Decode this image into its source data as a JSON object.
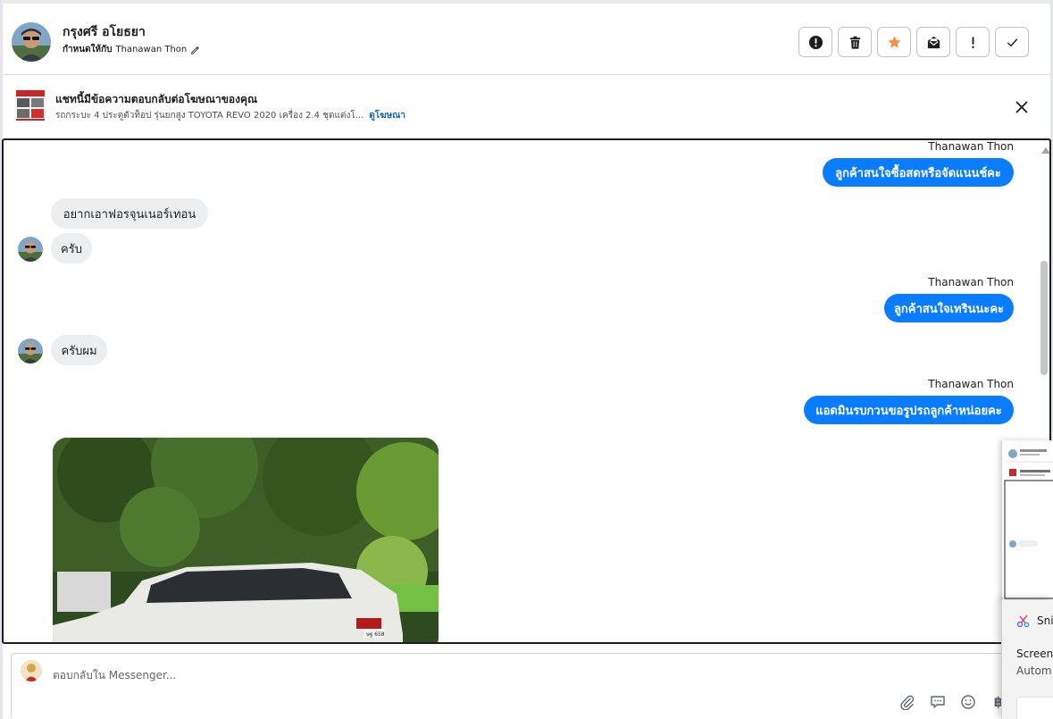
{
  "header": {
    "contact_name": "กรุงศรี อโยธยา",
    "assign_prefix": "กำหนดให้กับ",
    "assignee": "Thanawan Thon"
  },
  "toolbar": {
    "buttons": [
      {
        "name": "report-spam-button",
        "icon": "alert-circle-icon"
      },
      {
        "name": "delete-button",
        "icon": "trash-icon"
      },
      {
        "name": "star-button",
        "icon": "star-icon",
        "active_color": "#f7923b"
      },
      {
        "name": "mark-unread-button",
        "icon": "envelope-icon"
      },
      {
        "name": "follow-up-button",
        "icon": "exclamation-icon"
      },
      {
        "name": "mark-done-button",
        "icon": "checkmark-icon"
      }
    ]
  },
  "ad_banner": {
    "title": "แชทนี้มีข้อความตอบกลับต่อโฆษณาของคุณ",
    "description": "รถกระบะ 4 ประตูตัวท็อป รุ่นยกสูง TOYOTA REVO 2020 เครื่อง 2.4 ชุดแต่งโ...",
    "link_text": "ดูโฆษณา"
  },
  "messages": {
    "out1": {
      "sender": "Thanawan Thon",
      "text": "ลูกค้าสนใจซื้อสดหรือจัดแนนช์คะ"
    },
    "in1": {
      "text": "อยากเอาฟอรจุนเนอร์เทอน"
    },
    "in2": {
      "text": "ครับ"
    },
    "out2": {
      "sender": "Thanawan Thon",
      "text": "ลูกค้าสนใจเทรินนะคะ"
    },
    "in3": {
      "text": "ครับผม"
    },
    "out3": {
      "sender": "Thanawan Thon",
      "text": "แอดมินรบกวนขอรูปรถลูกค้าหน่อยคะ"
    },
    "photo": {
      "plate": "ษฐ 658"
    }
  },
  "composer": {
    "placeholder": "ตอบกลับใน Messenger...",
    "tools": [
      "paperclip-icon",
      "speech-bubble-icon",
      "emoji-icon",
      "baht-icon"
    ],
    "baht_symbol": "฿"
  },
  "snip_overlay": {
    "title": "Snip",
    "line1": "Screen",
    "line2": "Autom"
  },
  "colors": {
    "outgoing_bubble": "#0a7cff",
    "incoming_bubble": "#eceeef",
    "link": "#1565c0"
  }
}
